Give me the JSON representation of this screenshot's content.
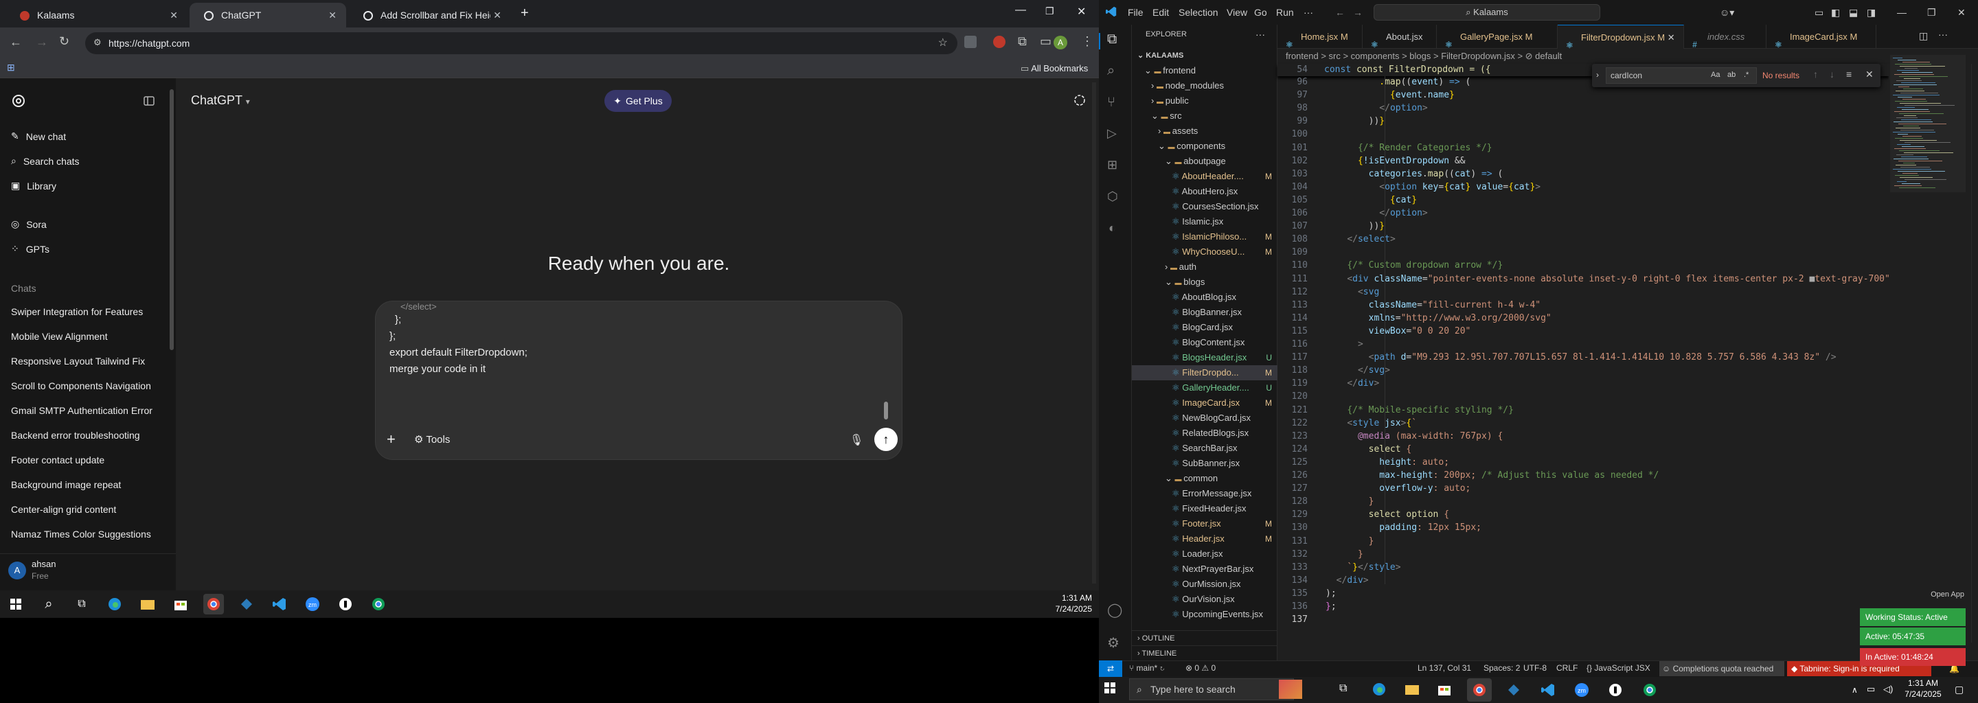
{
  "chrome": {
    "tabs": [
      {
        "title": "Kalaams"
      },
      {
        "title": "ChatGPT"
      },
      {
        "title": "Add Scrollbar and Fix Height fo"
      }
    ],
    "url": "https://chatgpt.com",
    "all_bookmarks": "All Bookmarks",
    "profile_letter": "A"
  },
  "chatgpt": {
    "model": "ChatGPT",
    "get_plus": "Get Plus",
    "new_chat": "New chat",
    "search_chats": "Search chats",
    "library": "Library",
    "sora": "Sora",
    "gpts": "GPTs",
    "chats_heading": "Chats",
    "chats": [
      "Swiper Integration for Features",
      "Mobile View Alignment",
      "Responsive Layout Tailwind Fix",
      "Scroll to Components Navigation",
      "Gmail SMTP Authentication Error",
      "Backend error troubleshooting",
      "Footer contact update",
      "Background image repeat",
      "Center-align grid content",
      "Namaz Times Color Suggestions"
    ],
    "user_name": "ahsan",
    "user_plan": "Free",
    "user_initial": "A",
    "heading": "Ready when you are.",
    "composer_lines": [
      "</select>",
      "};",
      "};",
      "export default FilterDropdown;",
      "merge your code in it"
    ],
    "tools": "Tools"
  },
  "taskbar_left": {
    "time": "1:31 AM",
    "date": "7/24/2025"
  },
  "vscode": {
    "menus": [
      "File",
      "Edit",
      "Selection",
      "View",
      "Go",
      "Run",
      "···"
    ],
    "search": "Kalaams",
    "explorer_title": "EXPLORER",
    "tree": [
      {
        "name": "KALAAMS",
        "mark": ""
      },
      {
        "name": "frontend",
        "mark": ""
      },
      {
        "name": "node_modules",
        "mark": ""
      },
      {
        "name": "public",
        "mark": ""
      },
      {
        "name": "src",
        "mark": ""
      },
      {
        "name": "assets",
        "mark": ""
      },
      {
        "name": "components",
        "mark": ""
      },
      {
        "name": "aboutpage",
        "mark": ""
      },
      {
        "name": "AboutHeader....",
        "mark": "M"
      },
      {
        "name": "AboutHero.jsx",
        "mark": ""
      },
      {
        "name": "CoursesSection.jsx",
        "mark": ""
      },
      {
        "name": "Islamic.jsx",
        "mark": ""
      },
      {
        "name": "IslamicPhiloso...",
        "mark": "M"
      },
      {
        "name": "WhyChooseU...",
        "mark": "M"
      },
      {
        "name": "auth",
        "mark": ""
      },
      {
        "name": "blogs",
        "mark": ""
      },
      {
        "name": "AboutBlog.jsx",
        "mark": ""
      },
      {
        "name": "BlogBanner.jsx",
        "mark": ""
      },
      {
        "name": "BlogCard.jsx",
        "mark": ""
      },
      {
        "name": "BlogContent.jsx",
        "mark": ""
      },
      {
        "name": "BlogsHeader.jsx",
        "mark": "U"
      },
      {
        "name": "FilterDropdo...",
        "mark": "M"
      },
      {
        "name": "GalleryHeader....",
        "mark": "U"
      },
      {
        "name": "ImageCard.jsx",
        "mark": "M"
      },
      {
        "name": "NewBlogCard.jsx",
        "mark": ""
      },
      {
        "name": "RelatedBlogs.jsx",
        "mark": ""
      },
      {
        "name": "SearchBar.jsx",
        "mark": ""
      },
      {
        "name": "SubBanner.jsx",
        "mark": ""
      },
      {
        "name": "common",
        "mark": ""
      },
      {
        "name": "ErrorMessage.jsx",
        "mark": ""
      },
      {
        "name": "FixedHeader.jsx",
        "mark": ""
      },
      {
        "name": "Footer.jsx",
        "mark": "M"
      },
      {
        "name": "Header.jsx",
        "mark": "M"
      },
      {
        "name": "Loader.jsx",
        "mark": ""
      },
      {
        "name": "NextPrayerBar.jsx",
        "mark": ""
      },
      {
        "name": "OurMission.jsx",
        "mark": ""
      },
      {
        "name": "OurVision.jsx",
        "mark": ""
      },
      {
        "name": "UpcomingEvents.jsx",
        "mark": ""
      }
    ],
    "outline": "OUTLINE",
    "timeline": "TIMELINE",
    "tabs": [
      {
        "name": "Home.jsx",
        "mark": "M"
      },
      {
        "name": "About.jsx",
        "mark": ""
      },
      {
        "name": "GalleryPage.jsx",
        "mark": "M"
      },
      {
        "name": "FilterDropdown.jsx",
        "mark": "M"
      },
      {
        "name": "index.css",
        "mark": ""
      },
      {
        "name": "ImageCard.jsx",
        "mark": "M"
      }
    ],
    "breadcrumb": "frontend > src > components > blogs > FilterDropdown.jsx > ⊘ default",
    "sticky_line_num": "54",
    "sticky_line": "const FilterDropdown = ({",
    "line_numbers": [
      "96",
      "97",
      "98",
      "99",
      "100",
      "101",
      "102",
      "103",
      "104",
      "105",
      "106",
      "107",
      "108",
      "109",
      "110",
      "111",
      "112",
      "113",
      "114",
      "115",
      "116",
      "117",
      "118",
      "119",
      "120",
      "121",
      "122",
      "123",
      "124",
      "125",
      "126",
      "127",
      "128",
      "129",
      "130",
      "131",
      "132",
      "133",
      "134",
      "135",
      "136",
      "137"
    ],
    "find_text": "cardIcon",
    "find_result": "No results",
    "status": {
      "branch": "main*",
      "problems": "⊗ 0 ⚠ 0",
      "position": "Ln 137, Col 31",
      "spaces": "Spaces: 2",
      "encoding": "UTF-8",
      "eol": "CRLF",
      "language": "JavaScript JSX",
      "completions": "Completions quota reached",
      "tabnine": "Tabnine: Sign-in is required"
    },
    "open_app": "Open App",
    "working_status": "Working Status: Active",
    "active_time": "Active: 05:47:35",
    "inactive_time": "In Active: 01:48:24"
  },
  "taskbar_right": {
    "search": "Type here to search",
    "time": "1:31 AM",
    "date": "7/24/2025"
  }
}
